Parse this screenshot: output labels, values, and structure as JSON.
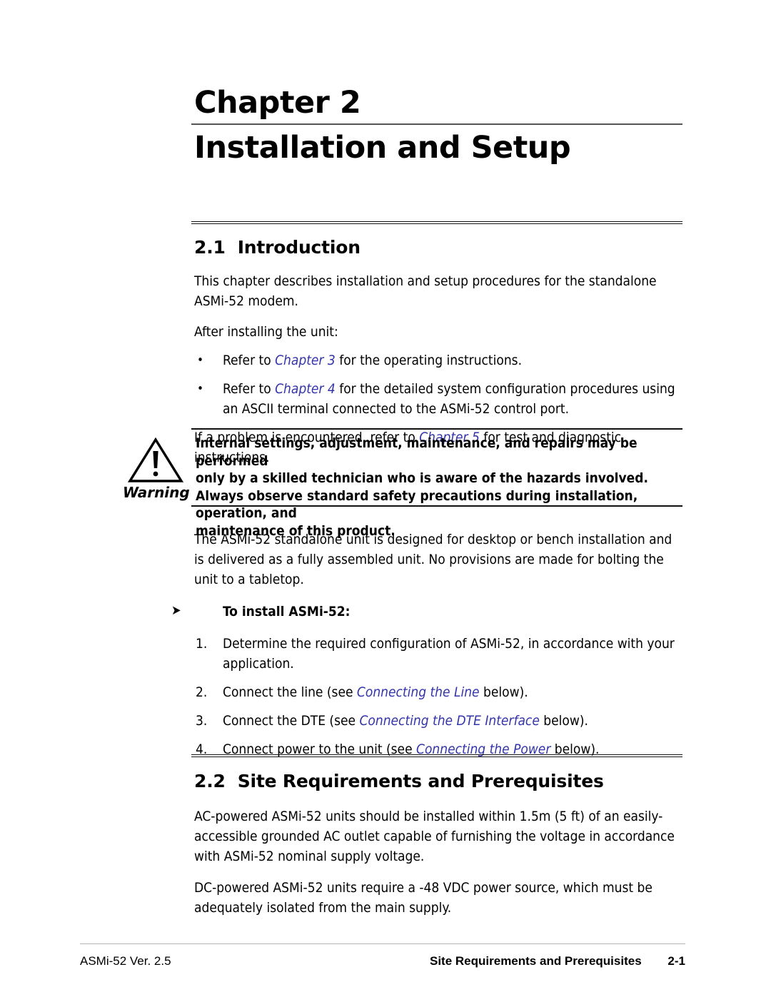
{
  "chapter": {
    "number_label": "Chapter 2",
    "title": "Installation and Setup"
  },
  "sections": {
    "s21": {
      "heading": "2.1  Introduction",
      "para1": "This chapter describes installation and setup procedures for the standalone ASMi-52 modem.",
      "para2": "After installing the unit:",
      "bullets": [
        {
          "marker": "•",
          "pre": "Refer to ",
          "xref": "Chapter 3",
          "post": " for the operating instructions."
        },
        {
          "marker": "•",
          "pre": "Refer to ",
          "xref": "Chapter 4",
          "post": " for the detailed system configuration procedures using an ASCII terminal connected to the ASMi-52 control port."
        }
      ],
      "para3_pre": "If a problem is encountered, refer to ",
      "para3_xref": "Chapter 5",
      "para3_post": " for test and diagnostic instructions.",
      "para4": "The ASMi-52 standalone unit is designed for desktop or bench installation and is delivered as a fully assembled unit. No provisions are made for bolting the unit to a tabletop.",
      "procedure_arrow": "➤",
      "procedure_heading": "To install ASMi-52:",
      "steps": [
        {
          "marker": "1.",
          "pre": "Determine the required configuration of ASMi-52, in accordance with your application.",
          "xref": "",
          "post": ""
        },
        {
          "marker": "2.",
          "pre": "Connect the line (see ",
          "xref": "Connecting the Line",
          "post": " below)."
        },
        {
          "marker": "3.",
          "pre": "Connect the DTE (see ",
          "xref": "Connecting the DTE Interface",
          "post": " below)."
        },
        {
          "marker": "4.",
          "pre": "Connect power to the unit (see ",
          "xref": "Connecting the Power",
          "post": " below)."
        }
      ]
    },
    "s22": {
      "heading": "2.2  Site Requirements and Prerequisites",
      "para1": "AC-powered ASMi-52 units should be installed within 1.5m (5 ft) of an easily-accessible grounded AC outlet capable of furnishing the voltage in accordance with ASMi-52 nominal supply voltage.",
      "para2": "DC-powered ASMi-52 units require a -48 VDC power source, which must be adequately isolated from the main supply."
    }
  },
  "warning": {
    "label": "Warning",
    "line1": "Internal settings, adjustment, maintenance, and repairs may be performed",
    "line2": "only by a skilled technician who is aware of the hazards involved.",
    "line3": "Always observe standard safety precautions during installation, operation, and",
    "line4": "maintenance of this product."
  },
  "footer": {
    "left": "ASMi-52 Ver. 2.5",
    "center": "Site Requirements and Prerequisites",
    "right": "2-1"
  },
  "colors": {
    "xref_blue": "#3333aa",
    "rule_black": "#111111",
    "footer_rule": "#b5b5b5"
  }
}
